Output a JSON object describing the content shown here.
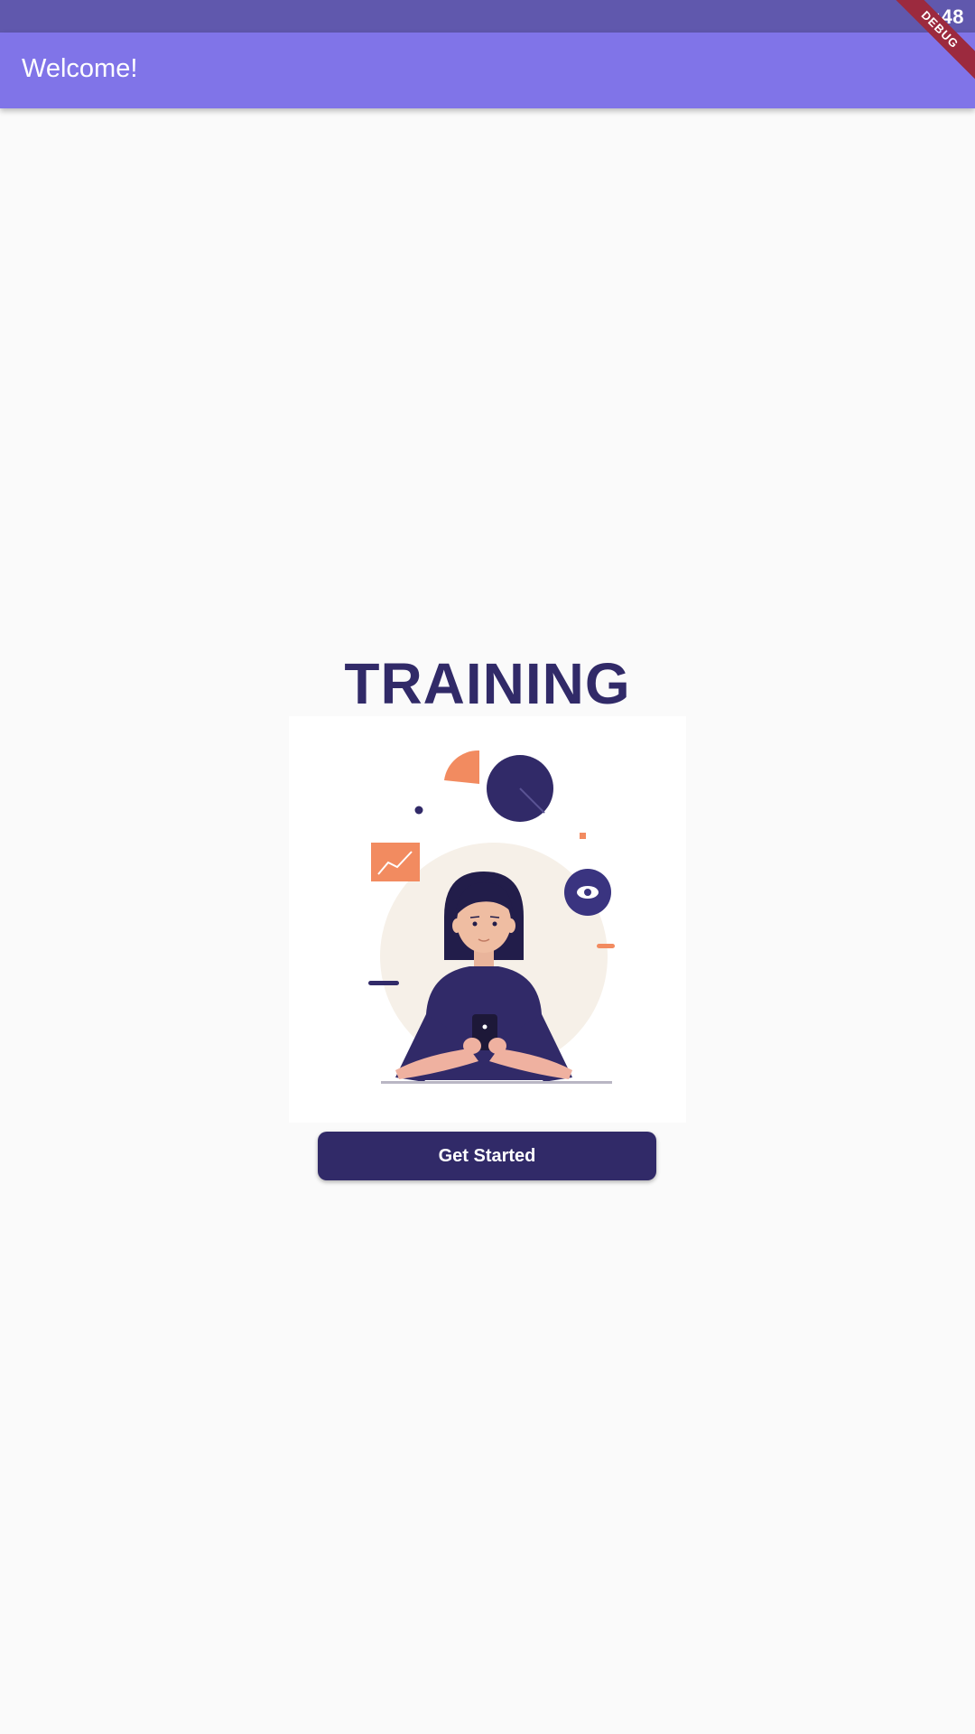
{
  "status_bar": {
    "time": "5:48"
  },
  "debug_banner": {
    "label": "DEBUG"
  },
  "app_bar": {
    "title": "Welcome!"
  },
  "main": {
    "heading": "TRAINING",
    "illustration_icon": "woman-with-phone-analytics-illustration",
    "button_label": "Get Started"
  },
  "colors": {
    "status_bar": "#6058ad",
    "app_bar": "#8074e8",
    "primary_dark": "#312a68",
    "accent_orange": "#f28b60",
    "background": "#fafafa",
    "debug_ribbon": "#9c2a3e"
  }
}
